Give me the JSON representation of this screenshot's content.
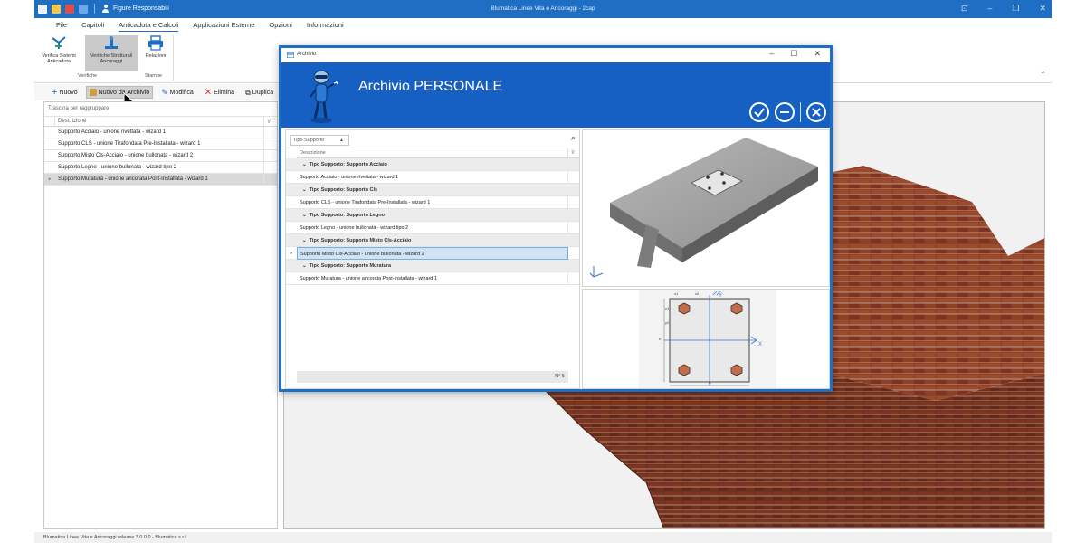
{
  "app": {
    "window_title": "Blumatica Linee Vita e Ancoraggi - 2cap",
    "user_label": "Figure Responsabili"
  },
  "menu": {
    "tabs": [
      "File",
      "Capitoli",
      "Anticaduta e Calcoli",
      "Applicazioni Esterne",
      "Opzioni",
      "Informazioni"
    ],
    "active": "Anticaduta e Calcoli"
  },
  "ribbon": {
    "btn_verifica": "Verifica Sistemi Anticaduta",
    "btn_verifica_l1": "Verifica Sistemi",
    "btn_verifica_l2": "Anticaduta",
    "btn_strutt_l1": "Verifiche Strutturali",
    "btn_strutt_l2": "Ancoraggi",
    "btn_relazioni": "Relazioni",
    "group_verifiche": "Verifiche",
    "group_stampe": "Stampe"
  },
  "toolbar": {
    "nuovo": "Nuovo",
    "nuovo_archivio": "Nuovo da Archivio",
    "modifica": "Modifica",
    "elimina": "Elimina",
    "duplica": "Duplica"
  },
  "left_grid": {
    "group_hint": "Trascina per raggruppare",
    "column": "Descrizione",
    "filter_glyph": "⊽",
    "rows": [
      "Supporto Acciaio - unione rivettata - wizard 1",
      "Supporto CLS - unione Tirafondata Pre-Installata - wizard 1",
      "Supporto Misto Cls-Acciaio - unione bullonata - wizard 2",
      "Supporto Legno - unione bullonata - wizard tipo 2",
      "Supporto Muratura - unione ancorata Post-Installata - wizard 1"
    ],
    "selected_index": 4
  },
  "dialog": {
    "window_title": "Archivio",
    "heading": "Archivio PERSONALE",
    "filter_label": "Tipo Supporto",
    "column": "Descrizione",
    "filter_glyph": "⊽",
    "groups": [
      {
        "label": "Tipo Supporto: Supporto Acciaio",
        "rows": [
          "Supporto Acciaio - unione rivettata - wizard 1"
        ]
      },
      {
        "label": "Tipo Supporto: Supporto Cls",
        "rows": [
          "Supporto CLS - unione Tirafondata Pre-Installata - wizard 1"
        ]
      },
      {
        "label": "Tipo Supporto: Supporto Legno",
        "rows": [
          "Supporto Legno - unione bullonata - wizard tipo 2"
        ]
      },
      {
        "label": "Tipo Supporto: Supporto Misto Cls-Acciaio",
        "rows": [
          "Supporto Misto Cls-Acciaio - unione bullonata - wizard 2"
        ]
      },
      {
        "label": "Tipo Supporto: Supporto Muratura",
        "rows": [
          "Supporto Muratura - unione ancorata Post-Installata - wizard 1"
        ]
      }
    ],
    "selected_row": "Supporto Misto Cls-Acciaio - unione bullonata - wizard 2",
    "count": "N° 5",
    "drawing_labels": {
      "x1": "x1",
      "x2": "x2",
      "y1": "y1",
      "y2": "y2",
      "h": "h",
      "B": "B",
      "axis_x": "X",
      "axis_y": "Y"
    }
  },
  "status": {
    "text": "Blumatica Linee Vita e Ancoraggi release 3.0.0.0 - Blumatica s.r.l."
  },
  "colors": {
    "brand_blue": "#1e6fc4",
    "dialog_header": "#1660c4",
    "selection": "#cfe3f5",
    "brick": "#8a3a22"
  }
}
